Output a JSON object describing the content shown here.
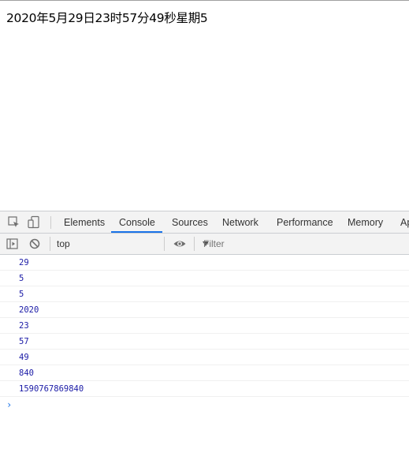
{
  "page": {
    "text": "2020年5月29日23时57分49秒星期5"
  },
  "devtools": {
    "tabs": [
      {
        "label": "Elements",
        "active": false
      },
      {
        "label": "Console",
        "active": true
      },
      {
        "label": "Sources",
        "active": false
      },
      {
        "label": "Network",
        "active": false
      },
      {
        "label": "Performance",
        "active": false
      },
      {
        "label": "Memory",
        "active": false
      },
      {
        "label": "Ap",
        "active": false
      }
    ],
    "toolbar": {
      "context": "top",
      "filter_placeholder": "Filter"
    },
    "console_logs": [
      "29",
      "5",
      "5",
      "2020",
      "23",
      "57",
      "49",
      "840",
      "1590767869840"
    ],
    "prompt_symbol": "›",
    "colors": {
      "accent": "#1a73e8",
      "log_text": "#1a1aa6",
      "toolbar_bg": "#f3f3f3"
    }
  }
}
